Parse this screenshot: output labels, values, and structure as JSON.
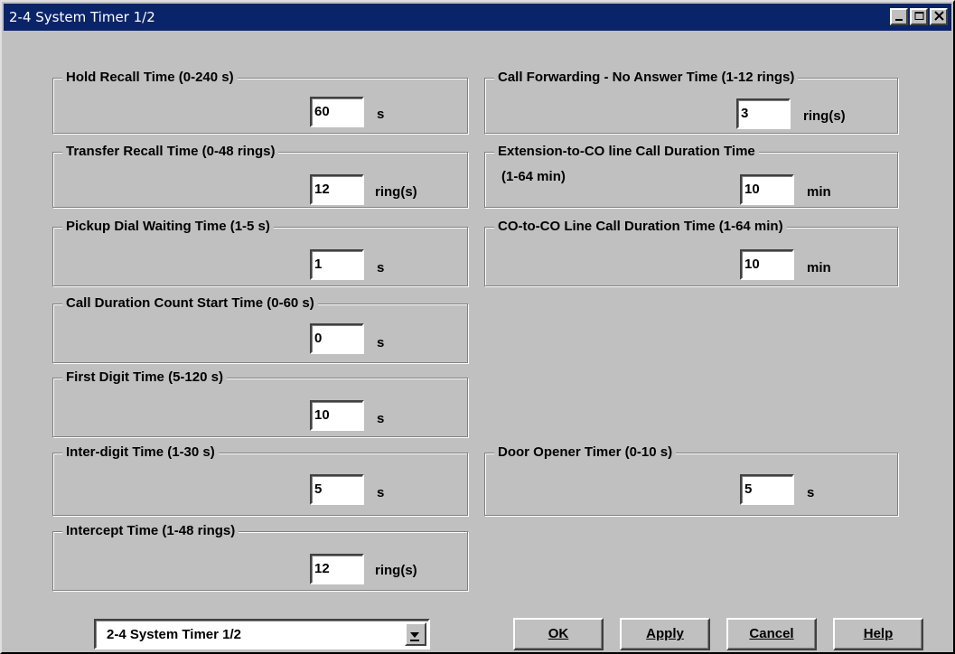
{
  "window": {
    "title": "2-4 System Timer 1/2"
  },
  "groups": {
    "hold_recall": {
      "title": "Hold Recall Time (0-240 s)",
      "value": "60",
      "unit": "s"
    },
    "transfer_recall": {
      "title": "Transfer Recall Time (0-48 rings)",
      "value": "12",
      "unit": "ring(s)"
    },
    "pickup_dial": {
      "title": "Pickup Dial Waiting Time (1-5 s)",
      "value": "1",
      "unit": "s"
    },
    "call_duration_count": {
      "title": "Call Duration Count Start Time (0-60 s)",
      "value": "0",
      "unit": "s"
    },
    "first_digit": {
      "title": "First Digit Time (5-120 s)",
      "value": "10",
      "unit": "s"
    },
    "inter_digit": {
      "title": "Inter-digit Time (1-30 s)",
      "value": "5",
      "unit": "s"
    },
    "intercept": {
      "title": "Intercept Time (1-48 rings)",
      "value": "12",
      "unit": "ring(s)"
    },
    "call_forwarding": {
      "title": "Call Forwarding - No Answer Time (1-12 rings)",
      "value": "3",
      "unit": "ring(s)"
    },
    "ext_to_co": {
      "title": "Extension-to-CO line Call Duration Time",
      "subtitle": "(1-64 min)",
      "value": "10",
      "unit": "min"
    },
    "co_to_co": {
      "title": "CO-to-CO Line Call Duration Time (1-64 min)",
      "value": "10",
      "unit": "min"
    },
    "door_opener": {
      "title": "Door Opener Timer (0-10 s)",
      "value": "5",
      "unit": "s"
    }
  },
  "footer": {
    "page_select": "2-4 System Timer 1/2",
    "ok_label": "OK",
    "apply_label": "Apply",
    "cancel_label": "Cancel",
    "help_label": "Help"
  },
  "icons": {
    "minimize": "minimize-icon",
    "maximize": "maximize-icon",
    "close": "close-icon",
    "dropdown": "dropdown-arrow-icon"
  },
  "colors": {
    "titlebar": "#0a246a",
    "face": "#c0c0c0"
  }
}
